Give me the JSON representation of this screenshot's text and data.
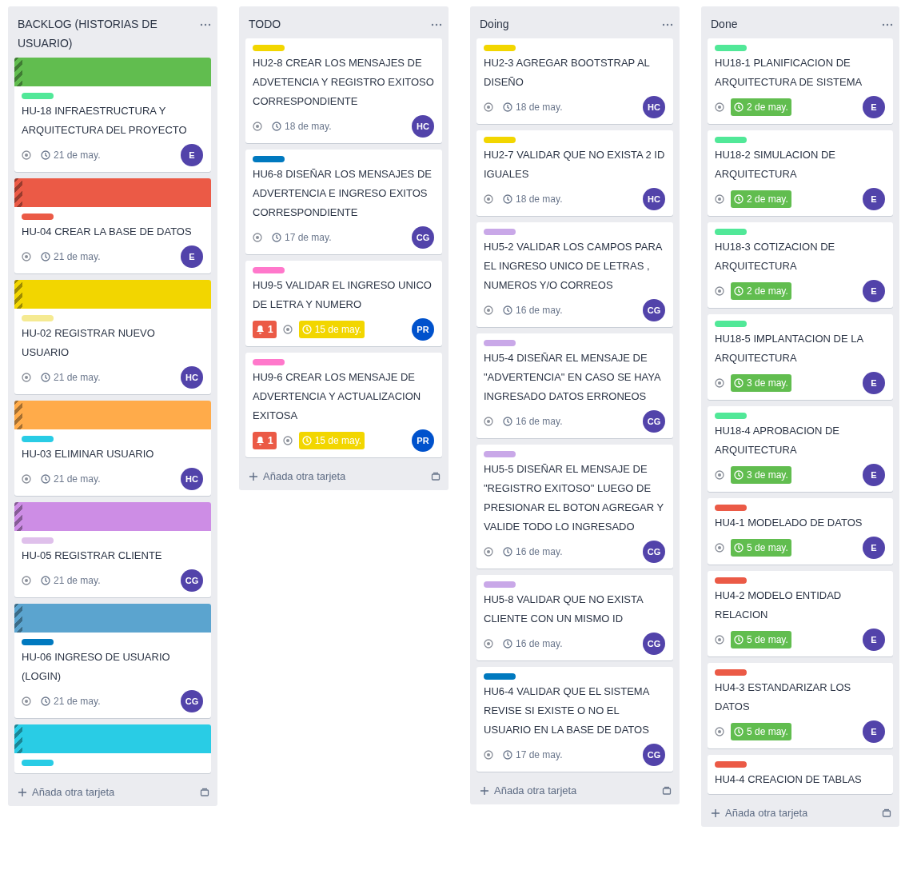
{
  "columns": [
    {
      "title": "BACKLOG (HISTORIAS DE USUARIO)",
      "add_card": "Añada otra tarjeta",
      "cards": [
        {
          "cover": {
            "color": "#61bd4f"
          },
          "label": {
            "color": "#51e898"
          },
          "title": "HU-18 INFRAESTRUCTURA Y ARQUITECTURA DEL PROYECTO",
          "watching": true,
          "date": {
            "text": "21 de may.",
            "kind": "plain"
          },
          "member": {
            "initials": "E",
            "color": "#5243aa"
          }
        },
        {
          "cover": {
            "color": "#eb5a46"
          },
          "label": {
            "color": "#eb5a46"
          },
          "title": "HU-04 CREAR LA BASE DE DATOS",
          "watching": true,
          "date": {
            "text": "21 de may.",
            "kind": "plain"
          },
          "member": {
            "initials": "E",
            "color": "#5243aa"
          }
        },
        {
          "cover": {
            "color": "#f2d600"
          },
          "label": {
            "color": "#f5ea92"
          },
          "title": "HU-02 REGISTRAR NUEVO USUARIO",
          "watching": true,
          "date": {
            "text": "21 de may.",
            "kind": "plain"
          },
          "member": {
            "initials": "HC",
            "color": "#5243aa"
          }
        },
        {
          "cover": {
            "color": "#ffab4a"
          },
          "label": {
            "color": "#29cce5"
          },
          "title": "HU-03 ELIMINAR USUARIO",
          "watching": true,
          "date": {
            "text": "21 de may.",
            "kind": "plain"
          },
          "member": {
            "initials": "HC",
            "color": "#5243aa"
          }
        },
        {
          "cover": {
            "color": "#cd8de5"
          },
          "label": {
            "color": "#dfc0eb"
          },
          "title": "HU-05 REGISTRAR CLIENTE",
          "watching": true,
          "date": {
            "text": "21 de may.",
            "kind": "plain"
          },
          "member": {
            "initials": "CG",
            "color": "#5243aa"
          }
        },
        {
          "cover": {
            "color": "#5ba4cf"
          },
          "label": {
            "color": "#0079bf"
          },
          "title": "HU-06 INGRESO DE USUARIO (LOGIN)",
          "watching": true,
          "date": {
            "text": "21 de may.",
            "kind": "plain"
          },
          "member": {
            "initials": "CG",
            "color": "#5243aa"
          }
        },
        {
          "cover": {
            "color": "#29cce5"
          },
          "label": {
            "color": "#29cce5"
          }
        }
      ]
    },
    {
      "title": "TODO",
      "add_card": "Añada otra tarjeta",
      "cards": [
        {
          "label": {
            "color": "#f2d600"
          },
          "title": "HU2-8 CREAR LOS MENSAJES DE ADVETENCIA Y REGISTRO EXITOSO CORRESPONDIENTE",
          "watching": true,
          "date": {
            "text": "18 de may.",
            "kind": "plain"
          },
          "member": {
            "initials": "HC",
            "color": "#5243aa"
          }
        },
        {
          "label": {
            "color": "#0079bf"
          },
          "title": "HU6-8 DISEÑAR LOS MENSAJES DE ADVERTENCIA E INGRESO EXITOS CORRESPONDIENTE",
          "watching": true,
          "date": {
            "text": "17 de may.",
            "kind": "plain"
          },
          "member": {
            "initials": "CG",
            "color": "#5243aa"
          }
        },
        {
          "label": {
            "color": "#ff78cb"
          },
          "title": "HU9-5 VALIDAR EL INGRESO UNICO DE LETRA Y NUMERO",
          "notifications": "1",
          "watching": true,
          "date": {
            "text": "15 de may.",
            "kind": "due_soon"
          },
          "member": {
            "initials": "PR",
            "color": "#0052cc"
          }
        },
        {
          "label": {
            "color": "#ff78cb"
          },
          "title": "HU9-6 CREAR LOS MENSAJE DE ADVERTENCIA Y ACTUALIZACION EXITOSA",
          "notifications": "1",
          "watching": true,
          "date": {
            "text": "15 de may.",
            "kind": "due_soon"
          },
          "member": {
            "initials": "PR",
            "color": "#0052cc"
          }
        }
      ]
    },
    {
      "title": "Doing",
      "add_card": "Añada otra tarjeta",
      "cards": [
        {
          "label": {
            "color": "#f2d600"
          },
          "title": "HU2-3 AGREGAR BOOTSTRAP AL DISEÑO",
          "watching": true,
          "date": {
            "text": "18 de may.",
            "kind": "plain"
          },
          "member": {
            "initials": "HC",
            "color": "#5243aa"
          }
        },
        {
          "label": {
            "color": "#f2d600"
          },
          "title": "HU2-7 VALIDAR QUE NO EXISTA 2 ID IGUALES",
          "watching": true,
          "date": {
            "text": "18 de may.",
            "kind": "plain"
          },
          "member": {
            "initials": "HC",
            "color": "#5243aa"
          }
        },
        {
          "label": {
            "color": "#c9a8e8"
          },
          "title": "HU5-2 VALIDAR LOS CAMPOS PARA EL INGRESO UNICO DE LETRAS , NUMEROS Y/O CORREOS",
          "watching": true,
          "date": {
            "text": "16 de may.",
            "kind": "plain"
          },
          "member": {
            "initials": "CG",
            "color": "#5243aa"
          }
        },
        {
          "label": {
            "color": "#c9a8e8"
          },
          "title": "HU5-4 DISEÑAR EL MENSAJE DE \"ADVERTENCIA\" EN CASO SE HAYA INGRESADO DATOS ERRONEOS",
          "watching": true,
          "date": {
            "text": "16 de may.",
            "kind": "plain"
          },
          "member": {
            "initials": "CG",
            "color": "#5243aa"
          }
        },
        {
          "label": {
            "color": "#c9a8e8"
          },
          "title": "HU5-5 DISEÑAR EL MENSAJE DE \"REGISTRO EXITOSO\" LUEGO DE PRESIONAR EL BOTON AGREGAR Y VALIDE TODO LO INGRESADO",
          "watching": true,
          "date": {
            "text": "16 de may.",
            "kind": "plain"
          },
          "member": {
            "initials": "CG",
            "color": "#5243aa"
          }
        },
        {
          "label": {
            "color": "#c9a8e8"
          },
          "title": "HU5-8 VALIDAR QUE NO EXISTA CLIENTE CON UN MISMO ID",
          "watching": true,
          "date": {
            "text": "16 de may.",
            "kind": "plain"
          },
          "member": {
            "initials": "CG",
            "color": "#5243aa"
          }
        },
        {
          "label": {
            "color": "#0079bf"
          },
          "title": "HU6-4 VALIDAR QUE EL SISTEMA REVISE SI EXISTE O NO EL USUARIO EN LA BASE DE DATOS",
          "watching": true,
          "date": {
            "text": "17 de may.",
            "kind": "plain"
          },
          "member": {
            "initials": "CG",
            "color": "#5243aa"
          }
        }
      ]
    },
    {
      "title": "Done",
      "add_card": "Añada otra tarjeta",
      "cards": [
        {
          "label": {
            "color": "#51e898"
          },
          "title": "HU18-1 PLANIFICACION DE ARQUITECTURA DE SISTEMA",
          "watching": true,
          "date": {
            "text": "2 de may.",
            "kind": "complete"
          },
          "member": {
            "initials": "E",
            "color": "#5243aa"
          }
        },
        {
          "label": {
            "color": "#51e898"
          },
          "title": "HU18-2 SIMULACION DE ARQUITECTURA",
          "watching": true,
          "date": {
            "text": "2 de may.",
            "kind": "complete"
          },
          "member": {
            "initials": "E",
            "color": "#5243aa"
          }
        },
        {
          "label": {
            "color": "#51e898"
          },
          "title": "HU18-3 COTIZACION DE ARQUITECTURA",
          "watching": true,
          "date": {
            "text": "2 de may.",
            "kind": "complete"
          },
          "member": {
            "initials": "E",
            "color": "#5243aa"
          }
        },
        {
          "label": {
            "color": "#51e898"
          },
          "title": "HU18-5 IMPLANTACION DE LA ARQUITECTURA",
          "watching": true,
          "date": {
            "text": "3 de may.",
            "kind": "complete"
          },
          "member": {
            "initials": "E",
            "color": "#5243aa"
          }
        },
        {
          "label": {
            "color": "#51e898"
          },
          "title": "HU18-4 APROBACION DE ARQUITECTURA",
          "watching": true,
          "date": {
            "text": "3 de may.",
            "kind": "complete"
          },
          "member": {
            "initials": "E",
            "color": "#5243aa"
          }
        },
        {
          "label": {
            "color": "#eb5a46"
          },
          "title": "HU4-1 MODELADO DE DATOS",
          "watching": true,
          "date": {
            "text": "5 de may.",
            "kind": "complete"
          },
          "member": {
            "initials": "E",
            "color": "#5243aa"
          }
        },
        {
          "label": {
            "color": "#eb5a46"
          },
          "title": "HU4-2 MODELO ENTIDAD RELACION",
          "watching": true,
          "date": {
            "text": "5 de may.",
            "kind": "complete"
          },
          "member": {
            "initials": "E",
            "color": "#5243aa"
          }
        },
        {
          "label": {
            "color": "#eb5a46"
          },
          "title": "HU4-3 ESTANDARIZAR LOS DATOS",
          "watching": true,
          "date": {
            "text": "5 de may.",
            "kind": "complete"
          },
          "member": {
            "initials": "E",
            "color": "#5243aa"
          }
        },
        {
          "label": {
            "color": "#eb5a46"
          },
          "title": "HU4-4 CREACION DE TABLAS"
        }
      ]
    }
  ]
}
